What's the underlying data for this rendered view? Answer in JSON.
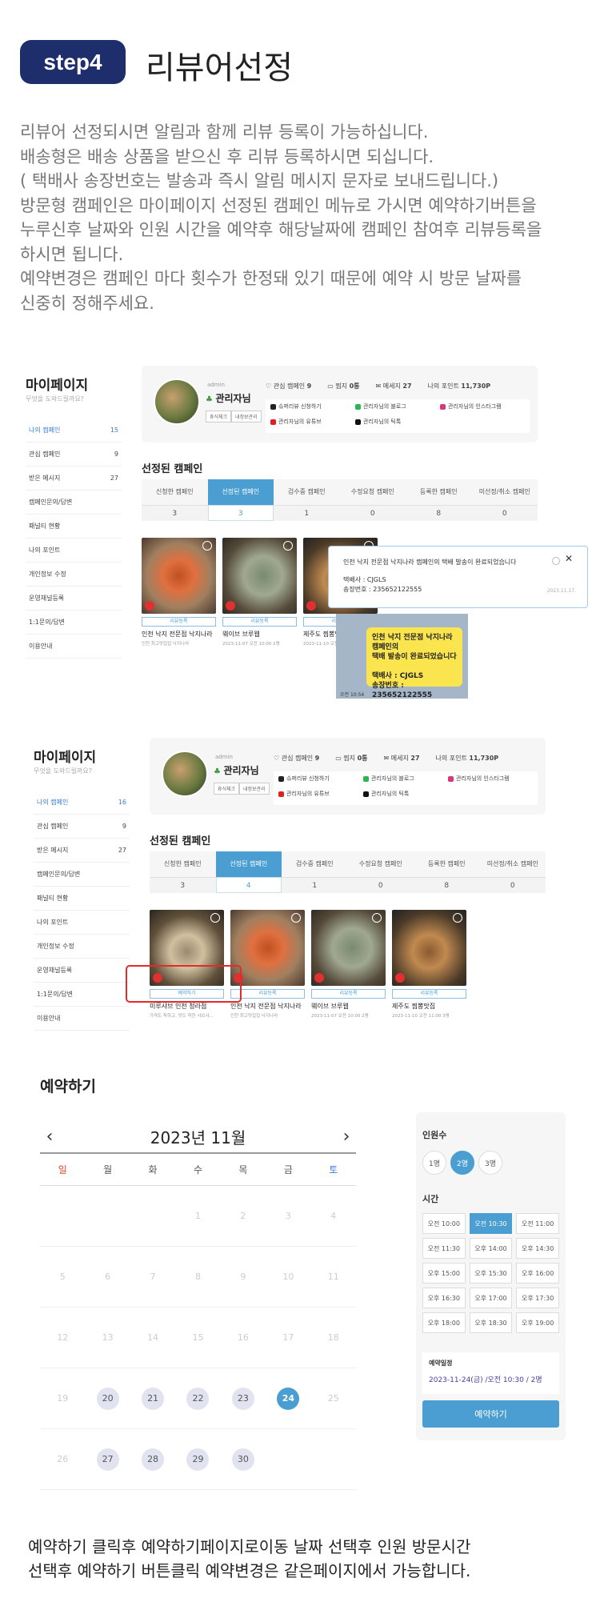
{
  "step_label": "step4",
  "title": "리뷰어선정",
  "intro": "리뷰어 선정되시면 알림과 함께 리뷰 등록이 가능하십니다.\n배송형은 배송 상품을 받으신 후 리뷰 등록하시면 되십니다.\n( 택배사 송장번호는 발송과 즉시 알림 메시지 문자로 보내드립니다.)\n방문형 캠페인은 마이페이지 선정된 캠페인 메뉴로 가시면 예약하기버튼을\n누루신후 날짜와 인원 시간을 예약후 해당날짜에 캠페인 참여후 리뷰등록을\n하시면 됩니다.\n예약변경은 캠페인 마다 횟수가 한정돼 있기 때문에 예약 시 방문 날짜를\n신중히 정해주세요.",
  "mypage": {
    "title": "마이페이지",
    "subtitle": "무엇을 도와드릴까요?",
    "profile": {
      "admin": "admin",
      "nickname": "관리자님",
      "mini_btns": [
        "휴식체크",
        "내정보관리"
      ],
      "stats": [
        {
          "label": "♡ 관심 캠페인",
          "value": "9"
        },
        {
          "label": "▭ 찜지",
          "value": "0통"
        },
        {
          "label": "✉ 메세지",
          "value": "27"
        },
        {
          "label": "나의 포인트",
          "value": "11,730P"
        }
      ],
      "links": [
        {
          "label": "슈퍼리뷰 신청하기",
          "color": "#222222"
        },
        {
          "label": "관리자님의 블로그",
          "color": "#2fb550"
        },
        {
          "label": "관리자님의 인스타그램",
          "color": "#d6367a"
        },
        {
          "label": "관리자님의 유튜브",
          "color": "#e02020"
        },
        {
          "label": "관리자님의 틱톡",
          "color": "#111111"
        }
      ]
    },
    "section_title": "선정된 캠페인",
    "tabs": [
      "신청한 캠페인",
      "선정된 캠페인",
      "검수중 캠페인",
      "수정요청 캠페인",
      "등록한 캠페인",
      "미선정/취소 캠페인"
    ]
  },
  "mypage1": {
    "menu": [
      {
        "label": "나의 캠페인",
        "count": "15"
      },
      {
        "label": "관심 캠페인",
        "count": "9"
      },
      {
        "label": "받은 메시지",
        "count": "27"
      },
      {
        "label": "캠페인문의/답변",
        "count": ""
      },
      {
        "label": "패널티 현황",
        "count": ""
      },
      {
        "label": "나의 포인트",
        "count": ""
      },
      {
        "label": "개인정보 수정",
        "count": ""
      },
      {
        "label": "운영채널등록",
        "count": ""
      },
      {
        "label": "1:1문의/답변",
        "count": ""
      },
      {
        "label": "이용안내",
        "count": ""
      }
    ],
    "tab_counts": [
      "3",
      "3",
      "1",
      "0",
      "8",
      "0"
    ],
    "cards": [
      {
        "button": "리뷰등록",
        "title": "인천 낙지 전문점 낙지나라",
        "meta": "인천 최고맛집집 낙지나라"
      },
      {
        "button": "리뷰등록",
        "title": "웨이브 브루웹",
        "meta": "2023-11-07 오전 10:00 2명"
      },
      {
        "button": "리뷰등록",
        "title": "제주도 찜뽕맛집",
        "meta": "2023-11-10 오전"
      }
    ],
    "toast": {
      "message": "인천 낙지 전문점 낙지나라 캠페인의 택배 발송이 완료되었습니다",
      "courier": "택배사 : CJGLS",
      "invoice": "송장번호 : 235652122555",
      "date": "2023.11.17."
    },
    "sms": {
      "text": "인천 낙지 전문점 낙지나라 캠페인의\n택배 발송이 완료되었습니다\n\n택배사 : CJGLS\n송장번호 : 235652122555",
      "time": "오전 10:54"
    }
  },
  "mypage2": {
    "menu": [
      {
        "label": "나의 캠페인",
        "count": "16"
      },
      {
        "label": "관심 캠페인",
        "count": "9"
      },
      {
        "label": "받은 메시지",
        "count": "27"
      },
      {
        "label": "캠페인문의/답변",
        "count": ""
      },
      {
        "label": "패널티 현황",
        "count": ""
      },
      {
        "label": "나의 포인트",
        "count": ""
      },
      {
        "label": "개인정보 수정",
        "count": ""
      },
      {
        "label": "운영채널등록",
        "count": ""
      },
      {
        "label": "1:1문의/답변",
        "count": ""
      },
      {
        "label": "이용안내",
        "count": ""
      }
    ],
    "tab_counts": [
      "3",
      "4",
      "1",
      "0",
      "8",
      "0"
    ],
    "cards": [
      {
        "button": "예약하기",
        "title": "미루샤브 인천 청라점",
        "meta": "가격도 착하고, 맛도 착한 샤브샤..."
      },
      {
        "button": "리뷰등록",
        "title": "인천 낙지 전문점 낙지나라",
        "meta": "인천 최고맛집집 낙지나라"
      },
      {
        "button": "리뷰등록",
        "title": "웨이브 브루웹",
        "meta": "2023-11-07 오전 10:00 2명"
      },
      {
        "button": "리뷰등록",
        "title": "제주도 찜뽕맛집",
        "meta": "2023-11-10 오전 11:00 3명"
      }
    ]
  },
  "reservation": {
    "title": "예약하기",
    "month": "2023년 11월",
    "prev": "‹",
    "next": "›",
    "weekdays": [
      "일",
      "월",
      "화",
      "수",
      "목",
      "금",
      "토"
    ],
    "weekday_colors": [
      "#e0452a",
      "#555555",
      "#555555",
      "#555555",
      "#555555",
      "#555555",
      "#3b7dd8"
    ],
    "days": [
      "",
      "",
      "",
      "1",
      "2",
      "3",
      "4",
      "5",
      "6",
      "7",
      "8",
      "9",
      "10",
      "11",
      "12",
      "13",
      "14",
      "15",
      "16",
      "17",
      "18",
      "19",
      "20",
      "21",
      "22",
      "23",
      "24",
      "25",
      "26",
      "27",
      "28",
      "29",
      "30",
      "",
      ""
    ],
    "available_days": [
      "20",
      "21",
      "22",
      "23",
      "27",
      "28",
      "29",
      "30"
    ],
    "selected_day": "24",
    "people_label": "인원수",
    "people": [
      "1명",
      "2명",
      "3명"
    ],
    "people_selected": "2명",
    "time_label": "시간",
    "times": [
      "오전 10:00",
      "오전 10:30",
      "오전 11:00",
      "오전 11:30",
      "오후 14:00",
      "오후 14:30",
      "오후 15:00",
      "오후 15:30",
      "오후 16:00",
      "오후 16:30",
      "오후 17:00",
      "오후 17:30",
      "오후 18:00",
      "오후 18:30",
      "오후 19:00"
    ],
    "time_selected": "오전 10:30",
    "schedule_label": "예약일정",
    "schedule_value": "2023-11-24(금) /오전 10:30 / 2명",
    "button": "예약하기"
  },
  "footer": "예약하기 클릭후 예약하기페이지로이동  날짜 선택후 인원 방문시간\n선택후 예약하기 버튼클릭  예약변경은  같은페이지에서 가능합니다."
}
